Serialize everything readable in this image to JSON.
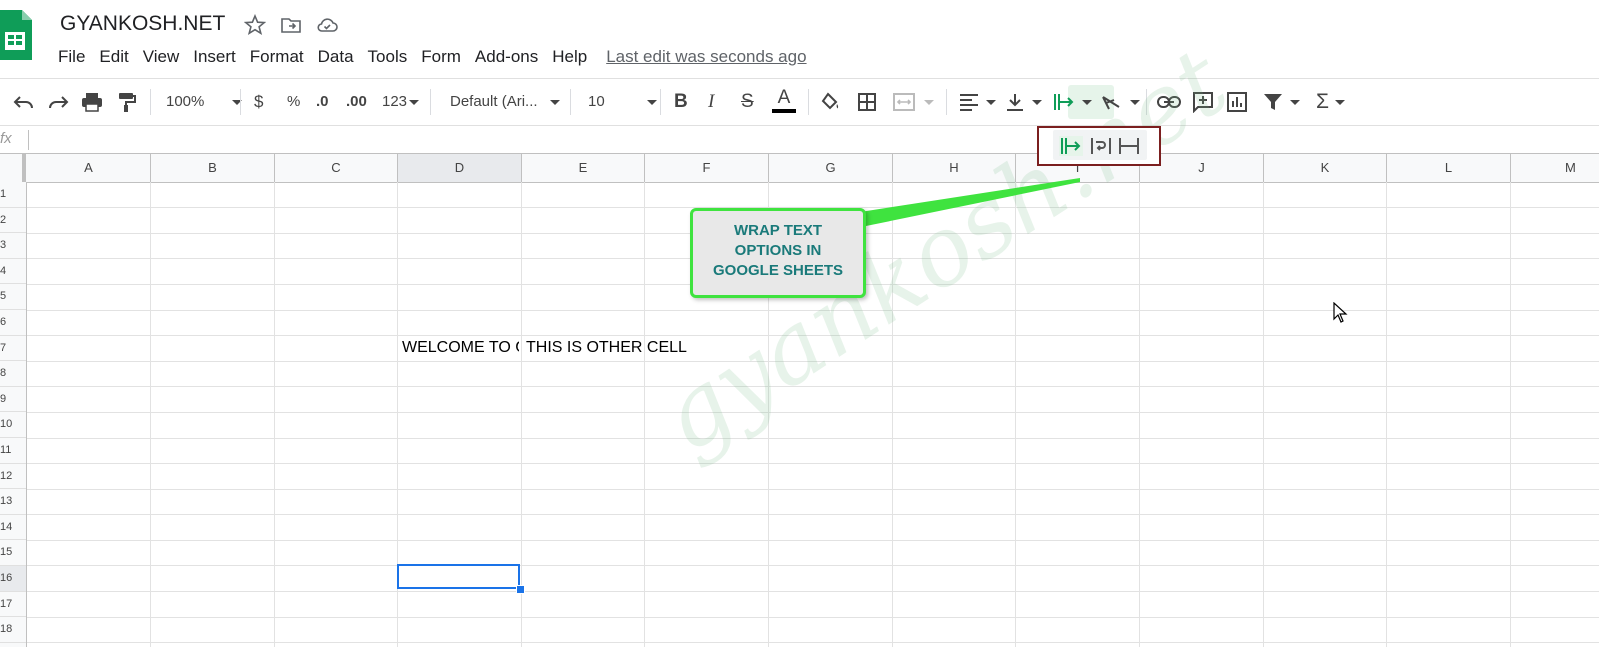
{
  "app": {
    "doc_title": "GYANKOSH.NET",
    "last_edit": "Last edit was seconds ago"
  },
  "menu": [
    "File",
    "Edit",
    "View",
    "Insert",
    "Format",
    "Data",
    "Tools",
    "Form",
    "Add-ons",
    "Help"
  ],
  "toolbar": {
    "zoom": "100%",
    "currency": "$",
    "percent": "%",
    "decrease_decimal": ".0",
    "increase_decimal": ".00",
    "more_formats": "123",
    "font": "Default (Ari...",
    "font_size": "10",
    "bold": "B",
    "italic": "I",
    "strike": "S",
    "text_color": "A",
    "functions": "Σ"
  },
  "formula_bar": {
    "fx": "fx"
  },
  "columns": [
    "A",
    "B",
    "C",
    "D",
    "E",
    "F",
    "G",
    "H",
    "I",
    "J",
    "K",
    "L",
    "M"
  ],
  "rows": [
    "1",
    "2",
    "3",
    "4",
    "5",
    "6",
    "7",
    "8",
    "9",
    "10",
    "11",
    "12",
    "13",
    "14",
    "15",
    "16",
    "17",
    "18"
  ],
  "cells": {
    "D7": "WELCOME TO G",
    "E7": "THIS IS OTHER CELL"
  },
  "callout": {
    "line1": "WRAP TEXT",
    "line2": "OPTIONS IN",
    "line3": "GOOGLE SHEETS"
  },
  "watermark": "gyankosh.net",
  "colors": {
    "accent": "#1a73e8",
    "sheets_green": "#0f9d58",
    "callout_border": "#3fe33f",
    "callout_text": "#1a7a7a",
    "popup_border": "#7b1f1f"
  }
}
